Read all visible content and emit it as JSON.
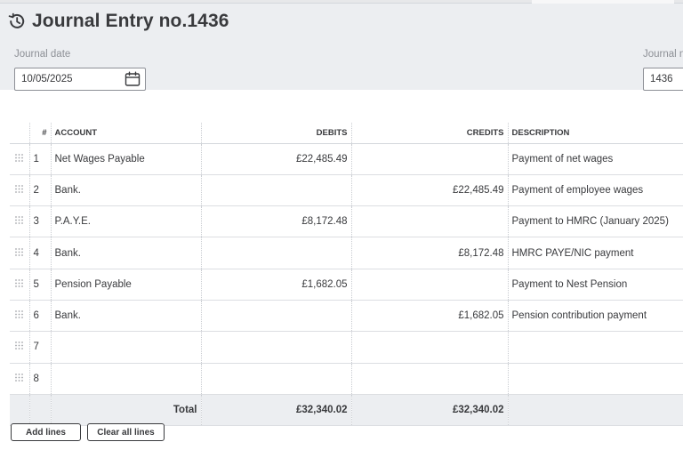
{
  "header": {
    "title": "Journal Entry no.1436",
    "icon": "history-icon",
    "date_label": "Journal date",
    "date_value": "10/05/2025",
    "journal_no_label": "Journal no.",
    "journal_no_value": "1436"
  },
  "table": {
    "columns": {
      "num": "#",
      "account": "ACCOUNT",
      "debits": "DEBITS",
      "credits": "CREDITS",
      "description": "DESCRIPTION"
    },
    "rows": [
      {
        "num": "1",
        "account": "Net Wages Payable",
        "debit": "£22,485.49",
        "credit": "",
        "description": "Payment of net wages"
      },
      {
        "num": "2",
        "account": "Bank.",
        "debit": "",
        "credit": "£22,485.49",
        "description": "Payment of employee  wages"
      },
      {
        "num": "3",
        "account": "P.A.Y.E.",
        "debit": "£8,172.48",
        "credit": "",
        "description": "Payment to HMRC (January 2025)"
      },
      {
        "num": "4",
        "account": "Bank.",
        "debit": "",
        "credit": "£8,172.48",
        "description": "HMRC PAYE/NIC payment"
      },
      {
        "num": "5",
        "account": "Pension Payable",
        "debit": "£1,682.05",
        "credit": "",
        "description": "Payment to Nest Pension"
      },
      {
        "num": "6",
        "account": "Bank.",
        "debit": "",
        "credit": "£1,682.05",
        "description": "Pension contribution payment"
      },
      {
        "num": "7",
        "account": "",
        "debit": "",
        "credit": "",
        "description": ""
      },
      {
        "num": "8",
        "account": "",
        "debit": "",
        "credit": "",
        "description": ""
      }
    ],
    "total": {
      "label": "Total",
      "debit": "£32,340.02",
      "credit": "£32,340.02"
    }
  },
  "actions": {
    "add_lines": "Add lines",
    "clear_all_lines": "Clear all lines"
  },
  "colors": {
    "header_bg": "#eceef1",
    "text": "#393a3d",
    "muted": "#8d9096"
  }
}
